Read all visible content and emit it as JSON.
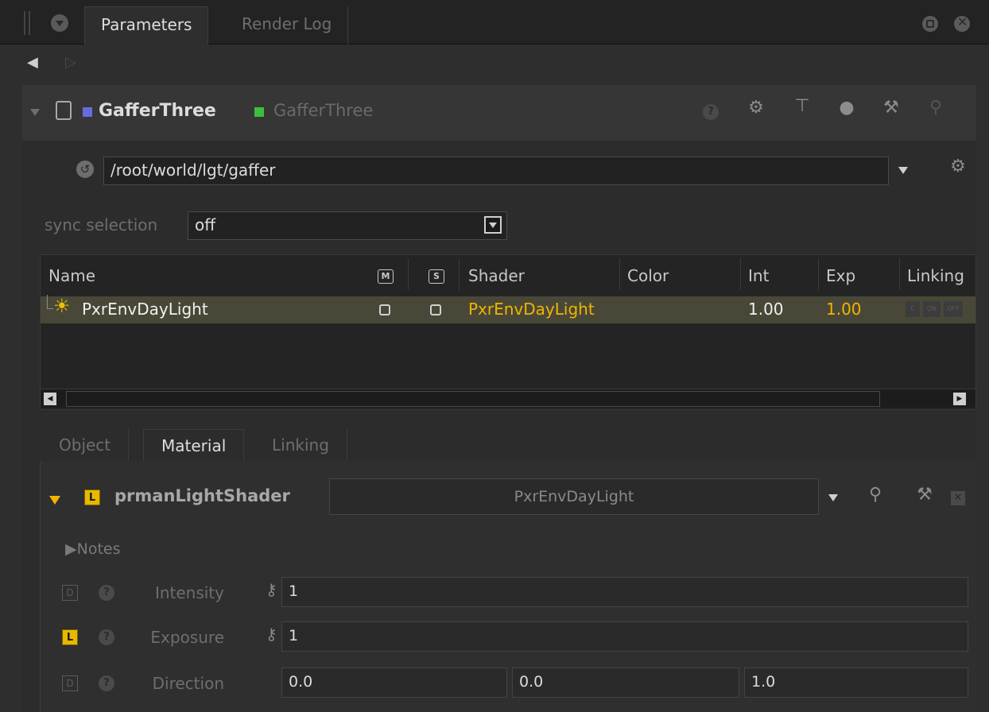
{
  "tabs": [
    "Parameters",
    "Render Log"
  ],
  "node": {
    "name": "GafferThree",
    "type": "GafferThree",
    "name_swatch_color": "#6a6adf",
    "type_swatch_color": "#3cbf3c"
  },
  "path": {
    "value": "/root/world/lgt/gaffer"
  },
  "sync": {
    "label": "sync selection",
    "value": "off"
  },
  "table": {
    "columns": [
      "Name",
      "M",
      "S",
      "Shader",
      "Color",
      "Int",
      "Exp",
      "Linking"
    ],
    "rows": [
      {
        "name": "PxrEnvDayLight",
        "shader": "PxrEnvDayLight",
        "int": "1.00",
        "exp": "1.00",
        "linking": [
          "C",
          "ON",
          "OFF"
        ]
      }
    ]
  },
  "subtabs": [
    "Object",
    "Material",
    "Linking"
  ],
  "material": {
    "section": "prmanLightShader",
    "shader": "PxrEnvDayLight",
    "notes_label": "Notes",
    "params": [
      {
        "label": "Intensity",
        "badge": "D",
        "value": "1"
      },
      {
        "label": "Exposure",
        "badge": "L",
        "value": "1"
      },
      {
        "label": "Direction",
        "badge": "D",
        "values": [
          "0.0",
          "0.0",
          "1.0"
        ]
      }
    ]
  },
  "colors": {
    "highlight": "#f0b400",
    "row_selected": "#494838",
    "badge_local": "#e8b800"
  }
}
